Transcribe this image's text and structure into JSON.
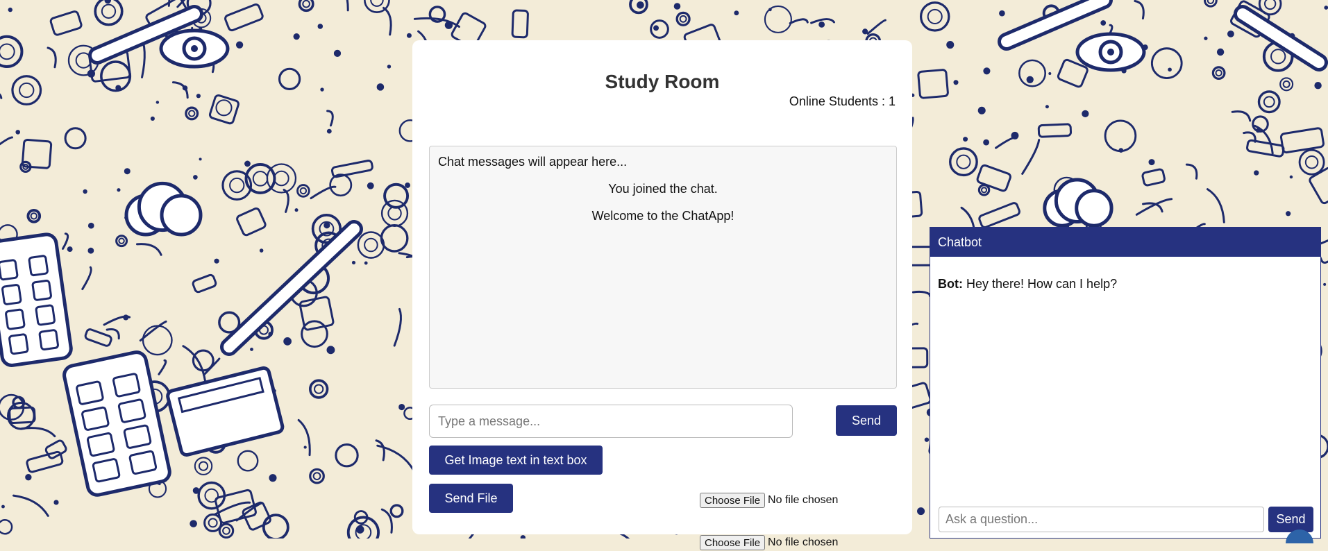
{
  "colors": {
    "accent": "#263280",
    "background_ink": "#1d2a6b",
    "background_paper": "#f3ecd8"
  },
  "background": {
    "icon_names": [
      "doodle-pattern",
      "cloud-icon",
      "eye-icon",
      "phone-icon",
      "calculator-icon",
      "pen-icon",
      "book-icon",
      "laptop-icon"
    ]
  },
  "room": {
    "title": "Study Room",
    "online_label": "Online Students :",
    "online_count": "1",
    "chat_placeholder": "Chat messages will appear here...",
    "messages": [
      "You joined the chat.",
      "Welcome to the ChatApp!"
    ],
    "message_input_placeholder": "Type a message...",
    "send_label": "Send",
    "image_text_button": "Get Image text in text box",
    "send_file_button": "Send File",
    "file_inputs": [
      {
        "button": "Choose File",
        "status": "No file chosen"
      },
      {
        "button": "Choose File",
        "status": "No file chosen"
      }
    ]
  },
  "chatbot": {
    "title": "Chatbot",
    "sender": "Bot:",
    "message": "Hey there! How can I help?",
    "input_placeholder": "Ask a question...",
    "send_label": "Send"
  }
}
